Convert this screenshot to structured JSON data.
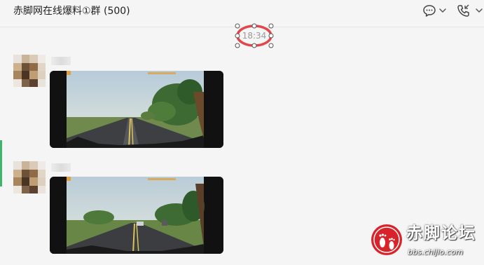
{
  "chat": {
    "title": "赤脚网在线爆料①群 (500)",
    "time_divider": "18:34"
  },
  "header": {
    "icons": [
      "chat-bubble-icon",
      "chevron-down-icon",
      "phone-icon",
      "chevron-down-icon"
    ]
  },
  "annotation": {
    "color": "#e0464b",
    "handle_color": "#555555"
  },
  "messages": [
    {
      "type": "video",
      "thumbnail": "dashcam road scene, trees on right"
    },
    {
      "type": "video",
      "thumbnail": "dashcam road scene, stopped vehicles ahead"
    }
  ],
  "colors": {
    "background": "#f5f5f5",
    "title_text": "#222222",
    "timestamp_text": "#9a9a9a",
    "watermark_red": "#d8232a"
  },
  "watermark": {
    "name": "赤脚论坛",
    "url": "bbs.chijio.com"
  }
}
